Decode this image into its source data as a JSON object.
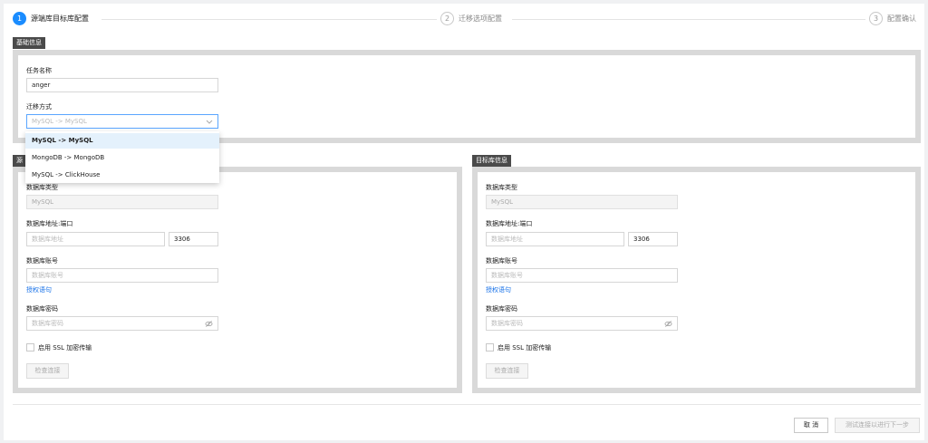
{
  "steps": [
    {
      "num": "1",
      "label": "源端库目标库配置"
    },
    {
      "num": "2",
      "label": "迁移选项配置"
    },
    {
      "num": "3",
      "label": "配置确认"
    }
  ],
  "basic": {
    "header": "基础信息",
    "task_name_label": "任务名称",
    "task_name_value": "anger",
    "migration_label": "迁移方式",
    "migration_value": "MySQL -> MySQL",
    "options": [
      "MySQL -> MySQL",
      "MongoDB -> MongoDB",
      "MySQL -> ClickHouse"
    ]
  },
  "source": {
    "header": "源",
    "db_type_label": "数据库类型",
    "db_type_value": "MySQL",
    "addr_label": "数据库地址:端口",
    "addr_placeholder": "数据库地址",
    "port_value": "3306",
    "account_label": "数据库账号",
    "account_placeholder": "数据库账号",
    "grant_link": "授权语句",
    "password_label": "数据库密码",
    "password_placeholder": "数据库密码",
    "ssl_label": "启用 SSL 加密传输",
    "check_button": "检查连接"
  },
  "target": {
    "header": "目标库信息",
    "db_type_label": "数据库类型",
    "db_type_value": "MySQL",
    "addr_label": "数据库地址:端口",
    "addr_placeholder": "数据库地址",
    "port_value": "3306",
    "account_label": "数据库账号",
    "account_placeholder": "数据库账号",
    "grant_link": "授权语句",
    "password_label": "数据库密码",
    "password_placeholder": "数据库密码",
    "ssl_label": "启用 SSL 加密传输",
    "check_button": "检查连接"
  },
  "footer": {
    "cancel": "取 消",
    "next": "测试连接以进行下一步"
  },
  "colors": {
    "accent": "#1a8cff",
    "link": "#1a73e8",
    "section_tag": "#4a4a4a"
  }
}
